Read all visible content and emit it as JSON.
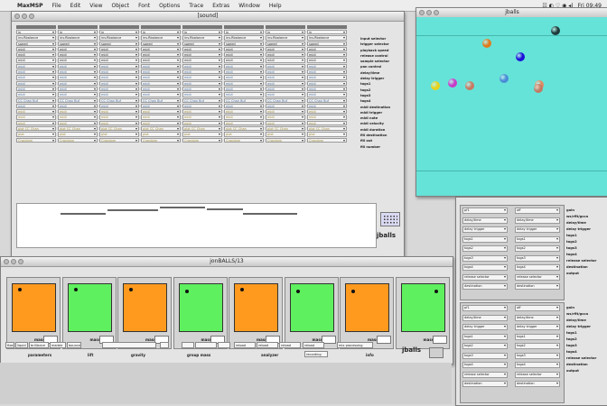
{
  "menubar": {
    "app": "MaxMSP",
    "items": [
      "File",
      "Edit",
      "View",
      "Object",
      "Font",
      "Options",
      "Trace",
      "Extras",
      "Window",
      "Help"
    ],
    "clock": "Fri 09:49"
  },
  "sound_window": {
    "title": "[sound]",
    "row_labels": [
      "input selector",
      "trigger selector",
      "playback speed",
      "release control",
      "sample selector",
      "pan control",
      "delay/time",
      "delay trigger",
      "togs1",
      "togs2",
      "togs3",
      "togs4",
      "midi destination",
      "midi trigger",
      "midi note",
      "midi velocity",
      "midi duration",
      "fill destination",
      "fill out",
      "fill number"
    ],
    "cell_texts": [
      "in",
      "inv.Rbalance",
      "speed",
      "midi",
      "midi",
      "midi",
      "midi",
      "midi",
      "midi",
      "midi",
      "midi",
      "midi",
      "CC Chan Buf",
      "midi",
      "midi",
      "midi",
      "midi",
      "plot CC Chan",
      "plot",
      "Crandom"
    ],
    "label": "jballs"
  },
  "jballs_window": {
    "title": "jballs",
    "balls": [
      {
        "color": "#1f3b3b"
      },
      {
        "color": "#e07b1e"
      },
      {
        "color": "#1a10d8"
      },
      {
        "color": "#4a8cd6"
      },
      {
        "color": "#e8d21a"
      },
      {
        "color": "#c83cc8"
      },
      {
        "color": "#c87a62"
      },
      {
        "color": "#e0885e"
      },
      {
        "color": "#c27a62"
      }
    ]
  },
  "side_window": {
    "labels_top": [
      "gain",
      "ws/rflt/gcca",
      "delay/time",
      "delay trigger",
      "togs1",
      "togs2",
      "togs3",
      "togs4",
      "release selector",
      "destination",
      "output"
    ],
    "labels_bottom": [
      "gain",
      "ws/rflt/gcca",
      "delay/time",
      "delay trigger",
      "togs1",
      "togs2",
      "togs3",
      "togs4",
      "release selector",
      "destination",
      "output"
    ],
    "cell_texts_left": [
      "pf1",
      "delay/time",
      "delay trigger",
      "togs1",
      "togs2",
      "togs3",
      "togs4",
      "release selector",
      "destination"
    ],
    "cell_texts_right": [
      "off",
      "delay/time",
      "delay trigger",
      "togs1",
      "togs2",
      "togs3",
      "togs4",
      "release selector",
      "destination"
    ]
  },
  "jon_window": {
    "title": "jonBALLS/13",
    "panels": [
      {
        "color": "#ff9a1f"
      },
      {
        "color": "#5ef05e"
      },
      {
        "color": "#ff9a1f"
      },
      {
        "color": "#5ef05e"
      },
      {
        "color": "#ff9a1f"
      },
      {
        "color": "#5ef05e"
      },
      {
        "color": "#ff9a1f"
      },
      {
        "color": "#5ef05e"
      }
    ],
    "mass_label": "mass",
    "controls": [
      "fixed",
      "liquid",
      "brilliance",
      "marble",
      "bounce",
      "",
      "",
      "",
      "",
      "",
      "reload",
      "reload",
      "reload",
      "reload",
      "mix processing",
      "recording"
    ],
    "section_labels": [
      "parameters",
      "lift",
      "gravity",
      "group mass",
      "analyzer",
      "info"
    ],
    "brand": "jballs"
  }
}
